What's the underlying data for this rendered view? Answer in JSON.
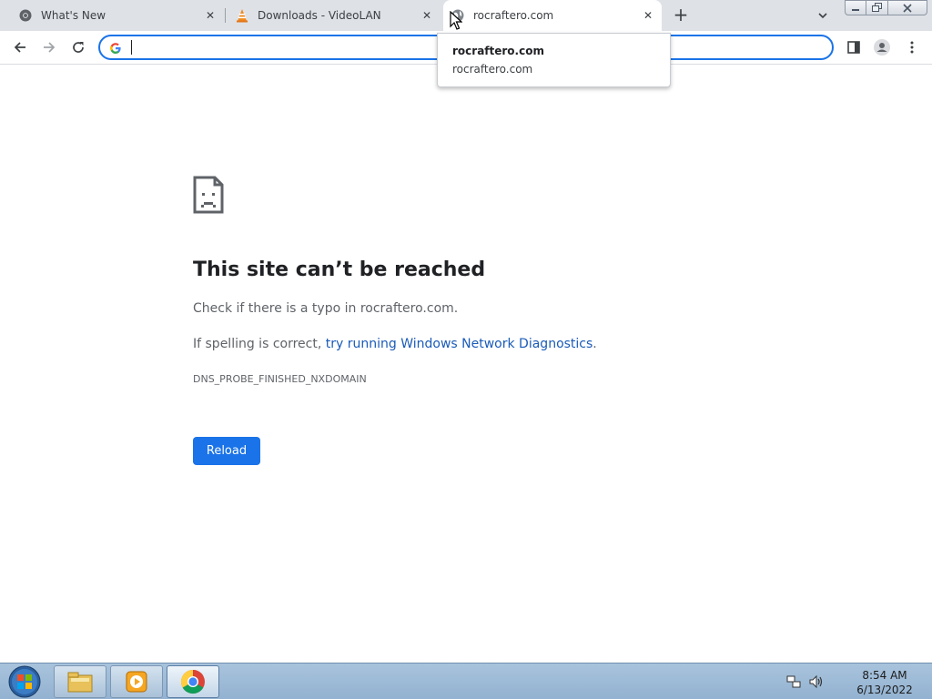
{
  "browser": {
    "tabs": [
      {
        "title": "What's New",
        "icon": "chrome-icon",
        "active": false
      },
      {
        "title": "Downloads - VideoLAN",
        "icon": "vlc-cone-icon",
        "active": false
      },
      {
        "title": "rocraftero.com",
        "icon": "globe-icon",
        "active": true
      }
    ],
    "hover_card": {
      "title": "rocraftero.com",
      "domain": "rocraftero.com"
    },
    "omnibox": {
      "value": "",
      "placeholder": ""
    }
  },
  "error_page": {
    "heading": "This site can’t be reached",
    "typo_text": "Check if there is a typo in rocraftero.com.",
    "spelling_prefix": "If spelling is correct, ",
    "diagnostics_link": "try running Windows Network Diagnostics",
    "spelling_suffix": ".",
    "error_code": "DNS_PROBE_FINISHED_NXDOMAIN",
    "reload_label": "Reload"
  },
  "taskbar": {
    "apps": [
      "explorer-icon",
      "media-player-icon",
      "chrome-icon"
    ],
    "clock_time": "8:54 AM",
    "clock_date": "6/13/2022"
  },
  "colors": {
    "accent": "#1a73e8",
    "link": "#1a5bb8",
    "tabstrip": "#dee1e6"
  }
}
